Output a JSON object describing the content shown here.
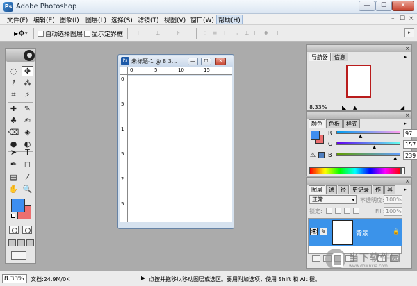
{
  "window": {
    "title": "Adobe Photoshop",
    "app_icon": "Ps",
    "min_glyph": "—",
    "max_glyph": "☐",
    "close_glyph": "✕"
  },
  "menu": {
    "items": [
      "文件(F)",
      "编辑(E)",
      "图象(I)",
      "图层(L)",
      "选择(S)",
      "滤镜(T)",
      "视图(V)",
      "窗口(W)",
      "帮助(H)"
    ],
    "active_index": 8,
    "doc_controls": [
      "–",
      "☐",
      "×"
    ]
  },
  "options_bar": {
    "tool_glyph": "▸✥",
    "tool_arrow": "▾",
    "auto_select_layer": "自动选择图层",
    "show_bounding_box": "显示定界框",
    "align_glyphs": [
      "⊤",
      "⊦",
      "⊥",
      "⊢",
      "⊧",
      "⊣",
      "⋮",
      "≡",
      "⊤",
      "⫟",
      "⊥",
      "⊢",
      "⋕",
      "⊣"
    ],
    "right_glyph": "▸"
  },
  "toolbox": {
    "tools": [
      "◌",
      "✥",
      "ℓ",
      "⁂",
      "⌗",
      "⚡",
      "✚",
      "✎",
      "♣",
      "✍",
      "⌫",
      "◈",
      "●",
      "◐",
      "➤",
      "T",
      "✒",
      "◻",
      "▤",
      "⁄",
      "✋",
      "🔍"
    ]
  },
  "document": {
    "title": "未标题-1 @ 8.3...",
    "icon": "Ps",
    "ruler_top_labels": [
      "0",
      "5",
      "10",
      "15"
    ],
    "ruler_left_labels": [
      "0",
      "5",
      "1",
      "5",
      "2",
      "5"
    ],
    "buttons": [
      "—",
      "☐",
      "✕"
    ]
  },
  "navigator": {
    "tabs": [
      "导航器",
      "信息"
    ],
    "zoom": "8.33%",
    "close_glyph": "×",
    "menu_glyph": "▸",
    "slider_thumb": "▲",
    "zoom_out_glyph": "◣",
    "zoom_in_glyph": "◢"
  },
  "color": {
    "tabs": [
      "颜色",
      "色板",
      "样式"
    ],
    "rows": [
      {
        "label": "R",
        "value": "97",
        "thumb": "▲"
      },
      {
        "label": "G",
        "value": "157",
        "thumb": "▲"
      },
      {
        "label": "B",
        "value": "239",
        "thumb": "▲"
      }
    ],
    "fg": "#3d8ef0",
    "bg": "#ec6f6f",
    "warning_glyph": "⚠",
    "close_glyph": "×",
    "menu_glyph": "▸"
  },
  "layers": {
    "tabs": [
      "图层",
      "通",
      "径",
      "史记录",
      "作",
      "具"
    ],
    "blend_mode": "正常",
    "blend_arrow": "▾",
    "opacity_label": "不透明度:",
    "opacity_value": "100%",
    "lock_label": "锁定:",
    "fill_label": "Fill:",
    "fill_value": "100%",
    "layer_name": "背景",
    "eye_glyph": "👁",
    "brush_glyph": "✎",
    "lock_glyph": "🔒",
    "close_glyph": "×",
    "menu_glyph": "▸"
  },
  "watermark": {
    "text": "当下软件园",
    "sub": "www.downxia.com"
  },
  "status": {
    "zoom": "8.33%",
    "doc_info": "文档:24.9M/0K",
    "arrow": "▶",
    "hint": "点按并拖移以移动图层或选区。要用附加选项，使用 Shift 和 Alt 键。"
  }
}
